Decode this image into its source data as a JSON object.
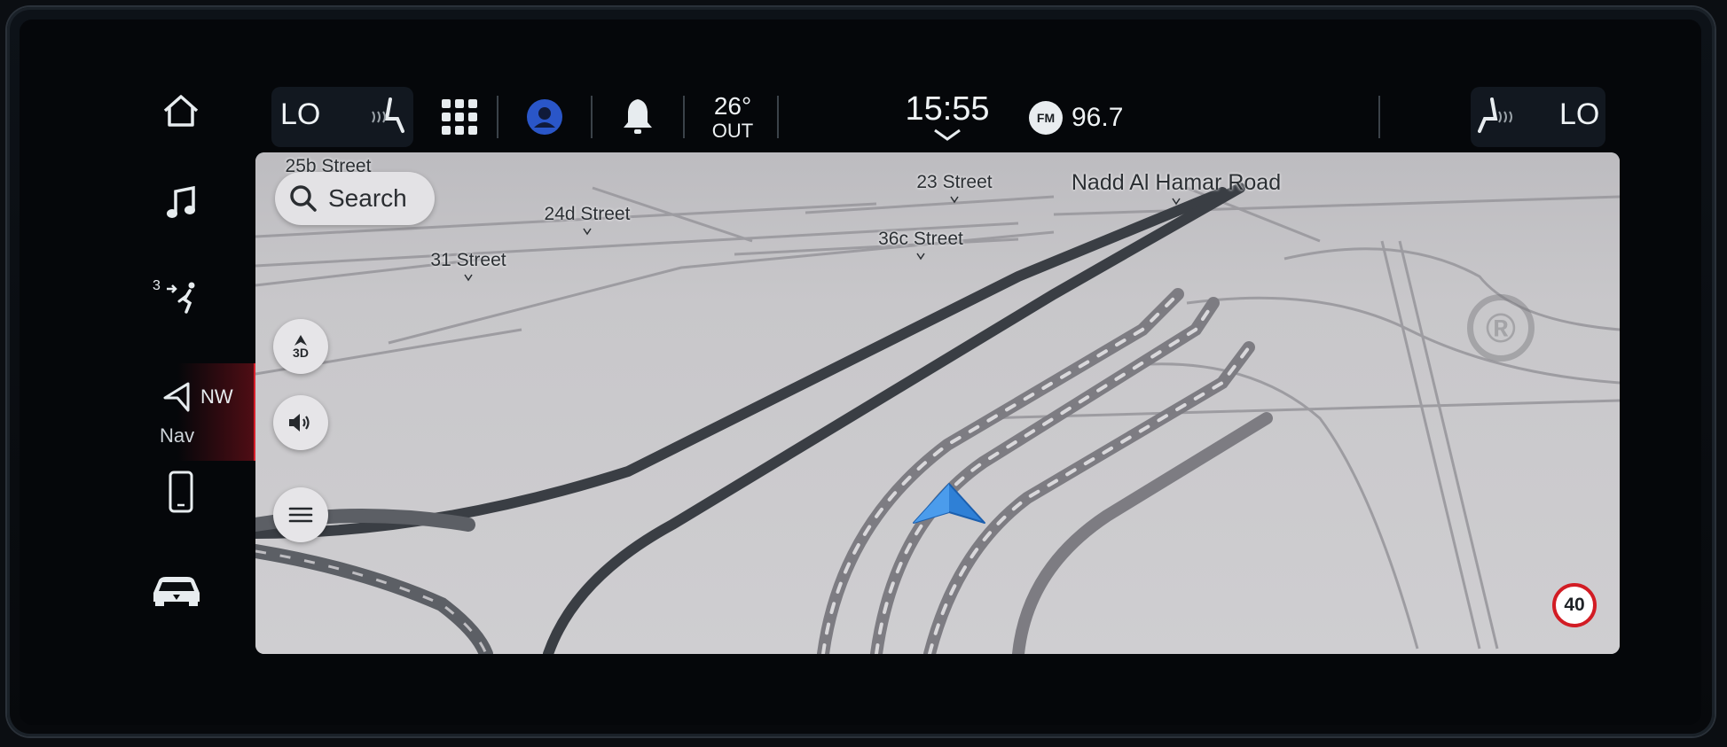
{
  "left_rail": {
    "home_icon": "home-icon",
    "music_icon": "music-note-icon",
    "climate": {
      "fan_level": "3",
      "icon": "fan-airflow-icon"
    },
    "nav": {
      "direction": "NW",
      "label": "Nav",
      "icon": "navigation-arrow-icon"
    },
    "phone_icon": "smartphone-icon",
    "vehicle_icon": "car-icon"
  },
  "topbar": {
    "left_temp": "LO",
    "left_seat_icon": "heated-seat-icon",
    "apps_icon": "app-grid-icon",
    "profile_icon": "user-profile-icon",
    "notifications_icon": "bell-icon",
    "outside_temp": "26°",
    "outside_label": "OUT",
    "clock": "15:55",
    "radio_band": "FM",
    "radio_freq": "96.7",
    "right_seat_icon": "heated-seat-icon",
    "right_temp": "LO"
  },
  "map": {
    "search_label": "Search",
    "streets": {
      "s25b": "25b Street",
      "s24d": "24d Street",
      "s31": "31 Street",
      "s23": "23 Street",
      "s36c": "36c Street",
      "nadd": "Nadd Al Hamar Road"
    },
    "view_mode": "3D",
    "speed_limit": "40",
    "colors": {
      "map_background": "#c7c6c9",
      "road_main": "#3a3e44",
      "vehicle_arrow": "#2f80d6",
      "speed_limit_ring": "#d21c24",
      "nav_active": "#d81f2a"
    }
  }
}
